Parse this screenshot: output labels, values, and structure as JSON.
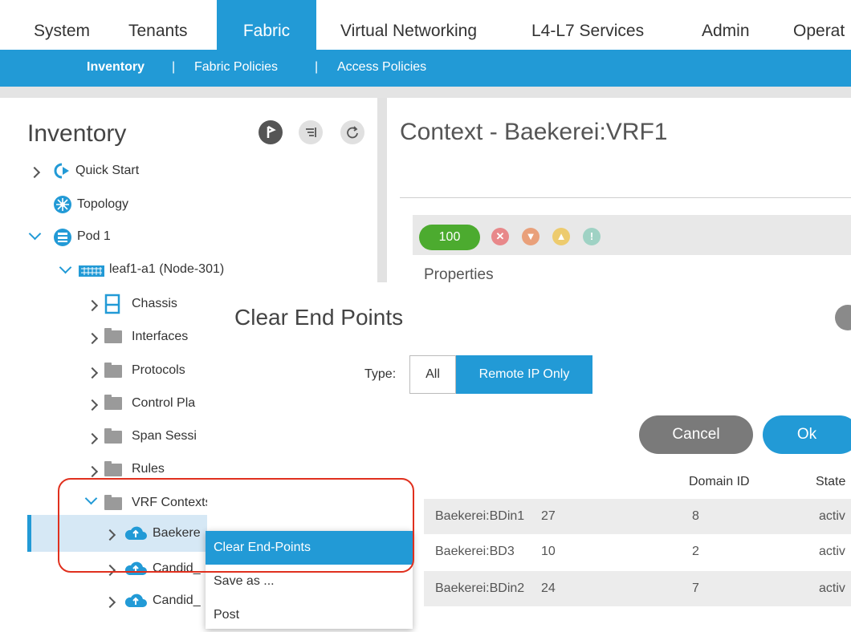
{
  "topnav": {
    "tabs": [
      "System",
      "Tenants",
      "Fabric",
      "Virtual Networking",
      "L4-L7 Services",
      "Admin",
      "Operat"
    ],
    "active_tab": "Fabric"
  },
  "subnav": {
    "items": [
      "Inventory",
      "Fabric Policies",
      "Access Policies"
    ],
    "separator": "|"
  },
  "sidebar": {
    "title": "Inventory",
    "tree": {
      "quick_start": "Quick Start",
      "topology": "Topology",
      "pod": "Pod 1",
      "leaf": "leaf1-a1 (Node-301)",
      "chassis": "Chassis",
      "interfaces": "Interfaces",
      "protocols": "Protocols",
      "control_plane": "Control Pla",
      "span_sessions": "Span Sessi",
      "rules": "Rules",
      "vrf_contexts": "VRF Contexts",
      "vrf_selected": "Baekere",
      "vrf_candid_1": "Candid_",
      "vrf_candid_2": "Candid_"
    }
  },
  "context_menu": {
    "items": [
      "Clear End-Points",
      "Save as ...",
      "Post"
    ]
  },
  "main": {
    "title": "Context - Baekerei:VRF1",
    "health_score": "100",
    "properties_label": "Properties"
  },
  "dialog": {
    "title": "Clear End Points",
    "type_label": "Type:",
    "type_options": [
      "All",
      "Remote IP Only"
    ],
    "selected_type": "Remote IP Only",
    "cancel_label": "Cancel",
    "ok_label": "Ok"
  },
  "table": {
    "headers": [
      "Domain ID",
      "State"
    ],
    "rows": [
      [
        "Baekerei:BDin1",
        "27",
        "8",
        "activ"
      ],
      [
        "Baekerei:BD3",
        "10",
        "2",
        "activ"
      ],
      [
        "Baekerei:BDin2",
        "24",
        "7",
        "activ"
      ]
    ]
  },
  "colors": {
    "accent": "#229ad6",
    "health_good": "#4cab2f",
    "highlight_outline": "#e0301e"
  }
}
